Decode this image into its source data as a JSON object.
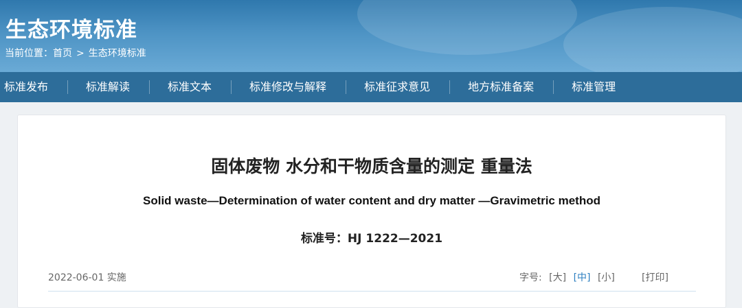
{
  "header": {
    "site_title": "生态环境标准",
    "breadcrumb_label": "当前位置：",
    "breadcrumb_home": "首页",
    "breadcrumb_sep": ">",
    "breadcrumb_current": "生态环境标准"
  },
  "nav": {
    "items": [
      {
        "label": "标准发布"
      },
      {
        "label": "标准解读"
      },
      {
        "label": "标准文本"
      },
      {
        "label": "标准修改与解释"
      },
      {
        "label": "标准征求意见"
      },
      {
        "label": "地方标准备案"
      },
      {
        "label": "标准管理"
      }
    ]
  },
  "document": {
    "title_cn": "固体废物 水分和干物质含量的测定 重量法",
    "title_en": "Solid waste—Determination of water content and dry matter —Gravimetric method",
    "standard_number": "标准号：HJ 1222—2021",
    "effective_date": "2022-06-01 实施"
  },
  "toolbar": {
    "font_size_label": "字号:",
    "font_large": "[大]",
    "font_medium": "[中]",
    "font_small": "[小]",
    "print": "[打印]"
  },
  "colors": {
    "nav_bg": "#2d6d9a",
    "banner_top": "#2f78ad",
    "active_link": "#2d7fc0"
  }
}
